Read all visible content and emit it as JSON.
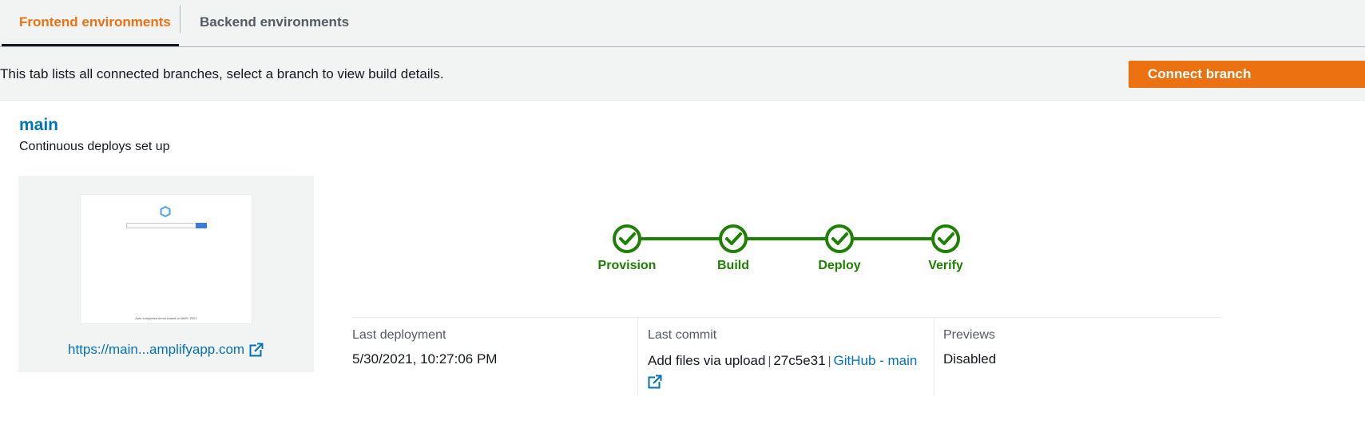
{
  "tabs": {
    "frontend": "Frontend environments",
    "backend": "Backend environments"
  },
  "infobar": {
    "text": "This tab lists all connected branches, select a branch to view build details.",
    "connect_button": "Connect branch"
  },
  "branch": {
    "name": "main",
    "subtitle": "Continuous deploys set up",
    "url": "https://main...amplifyapp.com",
    "url_icon": "external-link-icon",
    "thumbnail_footer": "Auto completed demo based on AWS. 2021"
  },
  "pipeline": {
    "stages": [
      {
        "label": "Provision",
        "status": "complete"
      },
      {
        "label": "Build",
        "status": "complete"
      },
      {
        "label": "Deploy",
        "status": "complete"
      },
      {
        "label": "Verify",
        "status": "complete"
      }
    ],
    "color": "#1d8102"
  },
  "details": {
    "last_deployment": {
      "label": "Last deployment",
      "value": "5/30/2021, 10:27:06 PM"
    },
    "last_commit": {
      "label": "Last commit",
      "message": "Add files via upload",
      "hash": "27c5e31",
      "repo_link": "GitHub - main",
      "separator": "|"
    },
    "previews": {
      "label": "Previews",
      "value": "Disabled"
    }
  },
  "colors": {
    "accent": "#ec7211",
    "link": "#0073bb",
    "success": "#1d8102"
  }
}
